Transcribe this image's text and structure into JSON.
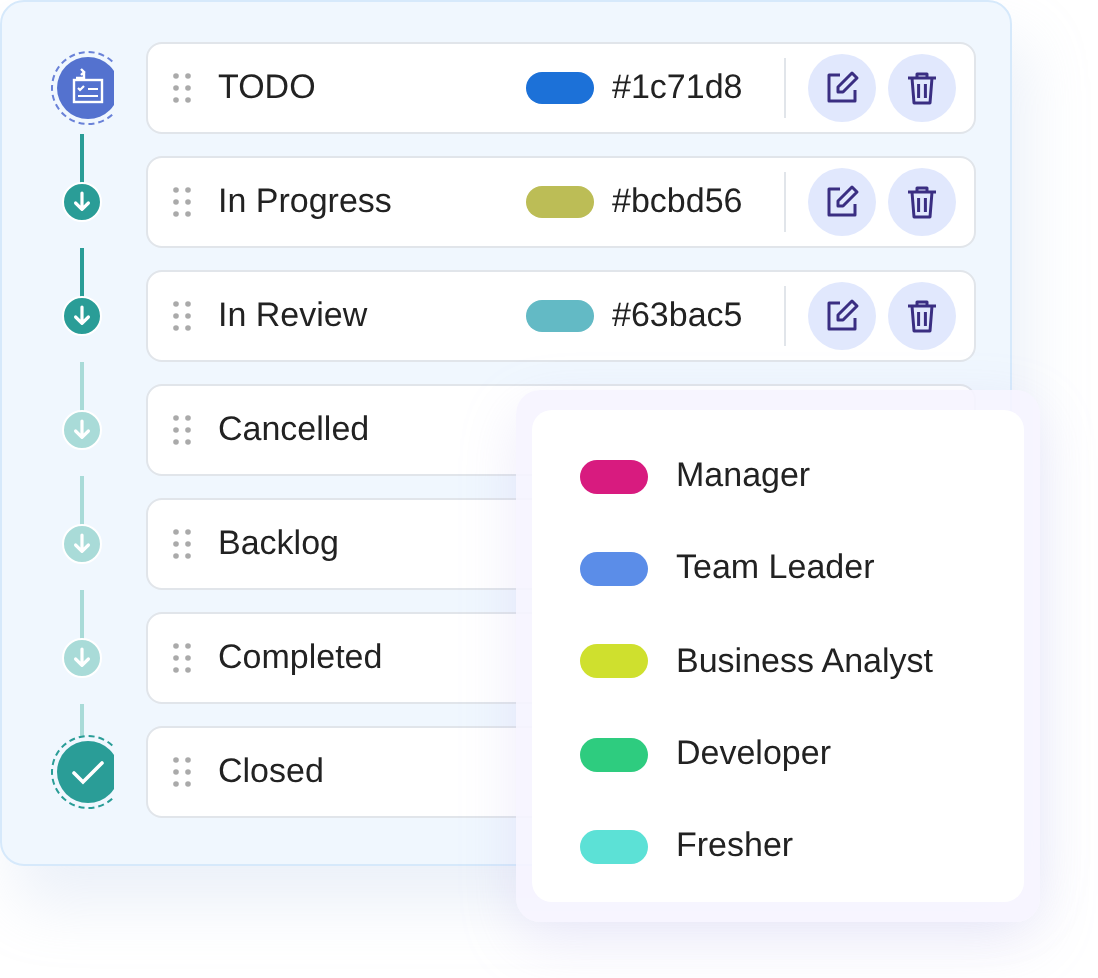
{
  "statuses": [
    {
      "name": "TODO",
      "kind": "start",
      "color": "#1c71d8",
      "code": "#1c71d8"
    },
    {
      "name": "In Progress",
      "kind": "done",
      "color": "#bcbd56",
      "code": "#bcbd56"
    },
    {
      "name": "In Review",
      "kind": "done",
      "color": "#63bac5",
      "code": "#63bac5"
    },
    {
      "name": "Cancelled",
      "kind": "pending"
    },
    {
      "name": "Backlog",
      "kind": "pending"
    },
    {
      "name": "Completed",
      "kind": "pending"
    },
    {
      "name": "Closed",
      "kind": "end"
    }
  ],
  "legend": [
    {
      "label": "Manager",
      "color": "#d81b7f"
    },
    {
      "label": "Team Leader",
      "color": "#5b8de8"
    },
    {
      "label": "Business Analyst",
      "color": "#cfe02e"
    },
    {
      "label": "Developer",
      "color": "#2ecc7f"
    },
    {
      "label": "Fresher",
      "color": "#5ce1d6"
    }
  ]
}
